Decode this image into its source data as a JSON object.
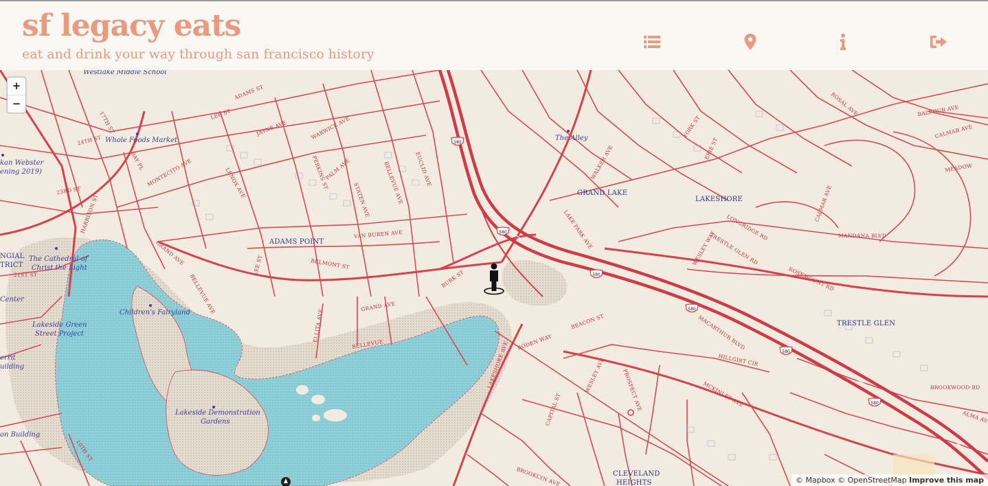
{
  "header": {
    "title": "sf legacy eats",
    "subtitle": "eat and drink your way through san francisco history"
  },
  "nav": [
    {
      "icon": "list-icon",
      "color": "#e99a7f"
    },
    {
      "icon": "map-pin-icon",
      "color": "#e99a7f"
    },
    {
      "icon": "info-icon",
      "color": "#e99a7f"
    },
    {
      "icon": "sign-out-icon",
      "color": "#e99a7f"
    }
  ],
  "map": {
    "zoom_in": "+",
    "zoom_out": "−",
    "attribution": {
      "mapbox": "© Mapbox",
      "osm": "© OpenStreetMap",
      "improve": "Improve this map"
    },
    "areas": [
      "ADAMS POINT",
      "GRAND LAKE",
      "LAKESHORE",
      "TRESTLE GLEN",
      "CLEVELAND",
      "HEIGHTS"
    ],
    "pois": [
      "Westlake Middle School",
      "Whole Foods Market",
      "The Alley",
      "The Cathedral of",
      "Christ the Light",
      "Children's Fairyland",
      "Lakeside Green",
      "Street Project",
      "Lakeside Demonstration",
      "Gardens",
      "kan Webster",
      "ening 2019)",
      "Center",
      "errit",
      "uilding",
      "on Building",
      "NGIAL",
      "TRICT"
    ],
    "streets": [
      "ADAMS ST",
      "LEE ST",
      "JAYNE AVE",
      "WARWICK AVE",
      "EUCLID AVE",
      "BELLEVUE AVE",
      "STATEN AVE",
      "PALM AVE",
      "PERKINS ST",
      "LENOX AVE",
      "MONTECITO AVE",
      "24TH ST",
      "23RD ST",
      "HARRISON ST",
      "GRAND AVE",
      "VAN BUREN AVE",
      "BELMONT ST",
      "LEE ST",
      "21ST ST",
      "BELLEVUE AVE",
      "ELLITA AVE",
      "BELLEVUE",
      "BURK ST",
      "GRAND AVE",
      "LAKESHORE AVE",
      "BODEN WAY",
      "BEACON ST",
      "WALKER AVE",
      "LAKE PARK AVE",
      "YORK ST",
      "ERIE ST",
      "LONGRIDGE RD",
      "TRESTLE GLEN RD",
      "WESLEY WAY",
      "ROSEMOUNT RD",
      "MANDANA BLVD",
      "CALMAR AVE",
      "BALFOUR AVE",
      "ROSAL AVE",
      "MACARTHUR BLVD",
      "HILLGIRT CIR",
      "MCKINLEY AVE",
      "WESLEY AVE",
      "PROSPECT AVE",
      "CAPITAL ST",
      "BROOKWOOD RD",
      "ALMA AVE",
      "BROOKLYN AVE",
      "10TH ST",
      "17TH ST",
      "BAY PL",
      "MEADOW",
      "CALMAR AVE"
    ],
    "highway": "580"
  }
}
